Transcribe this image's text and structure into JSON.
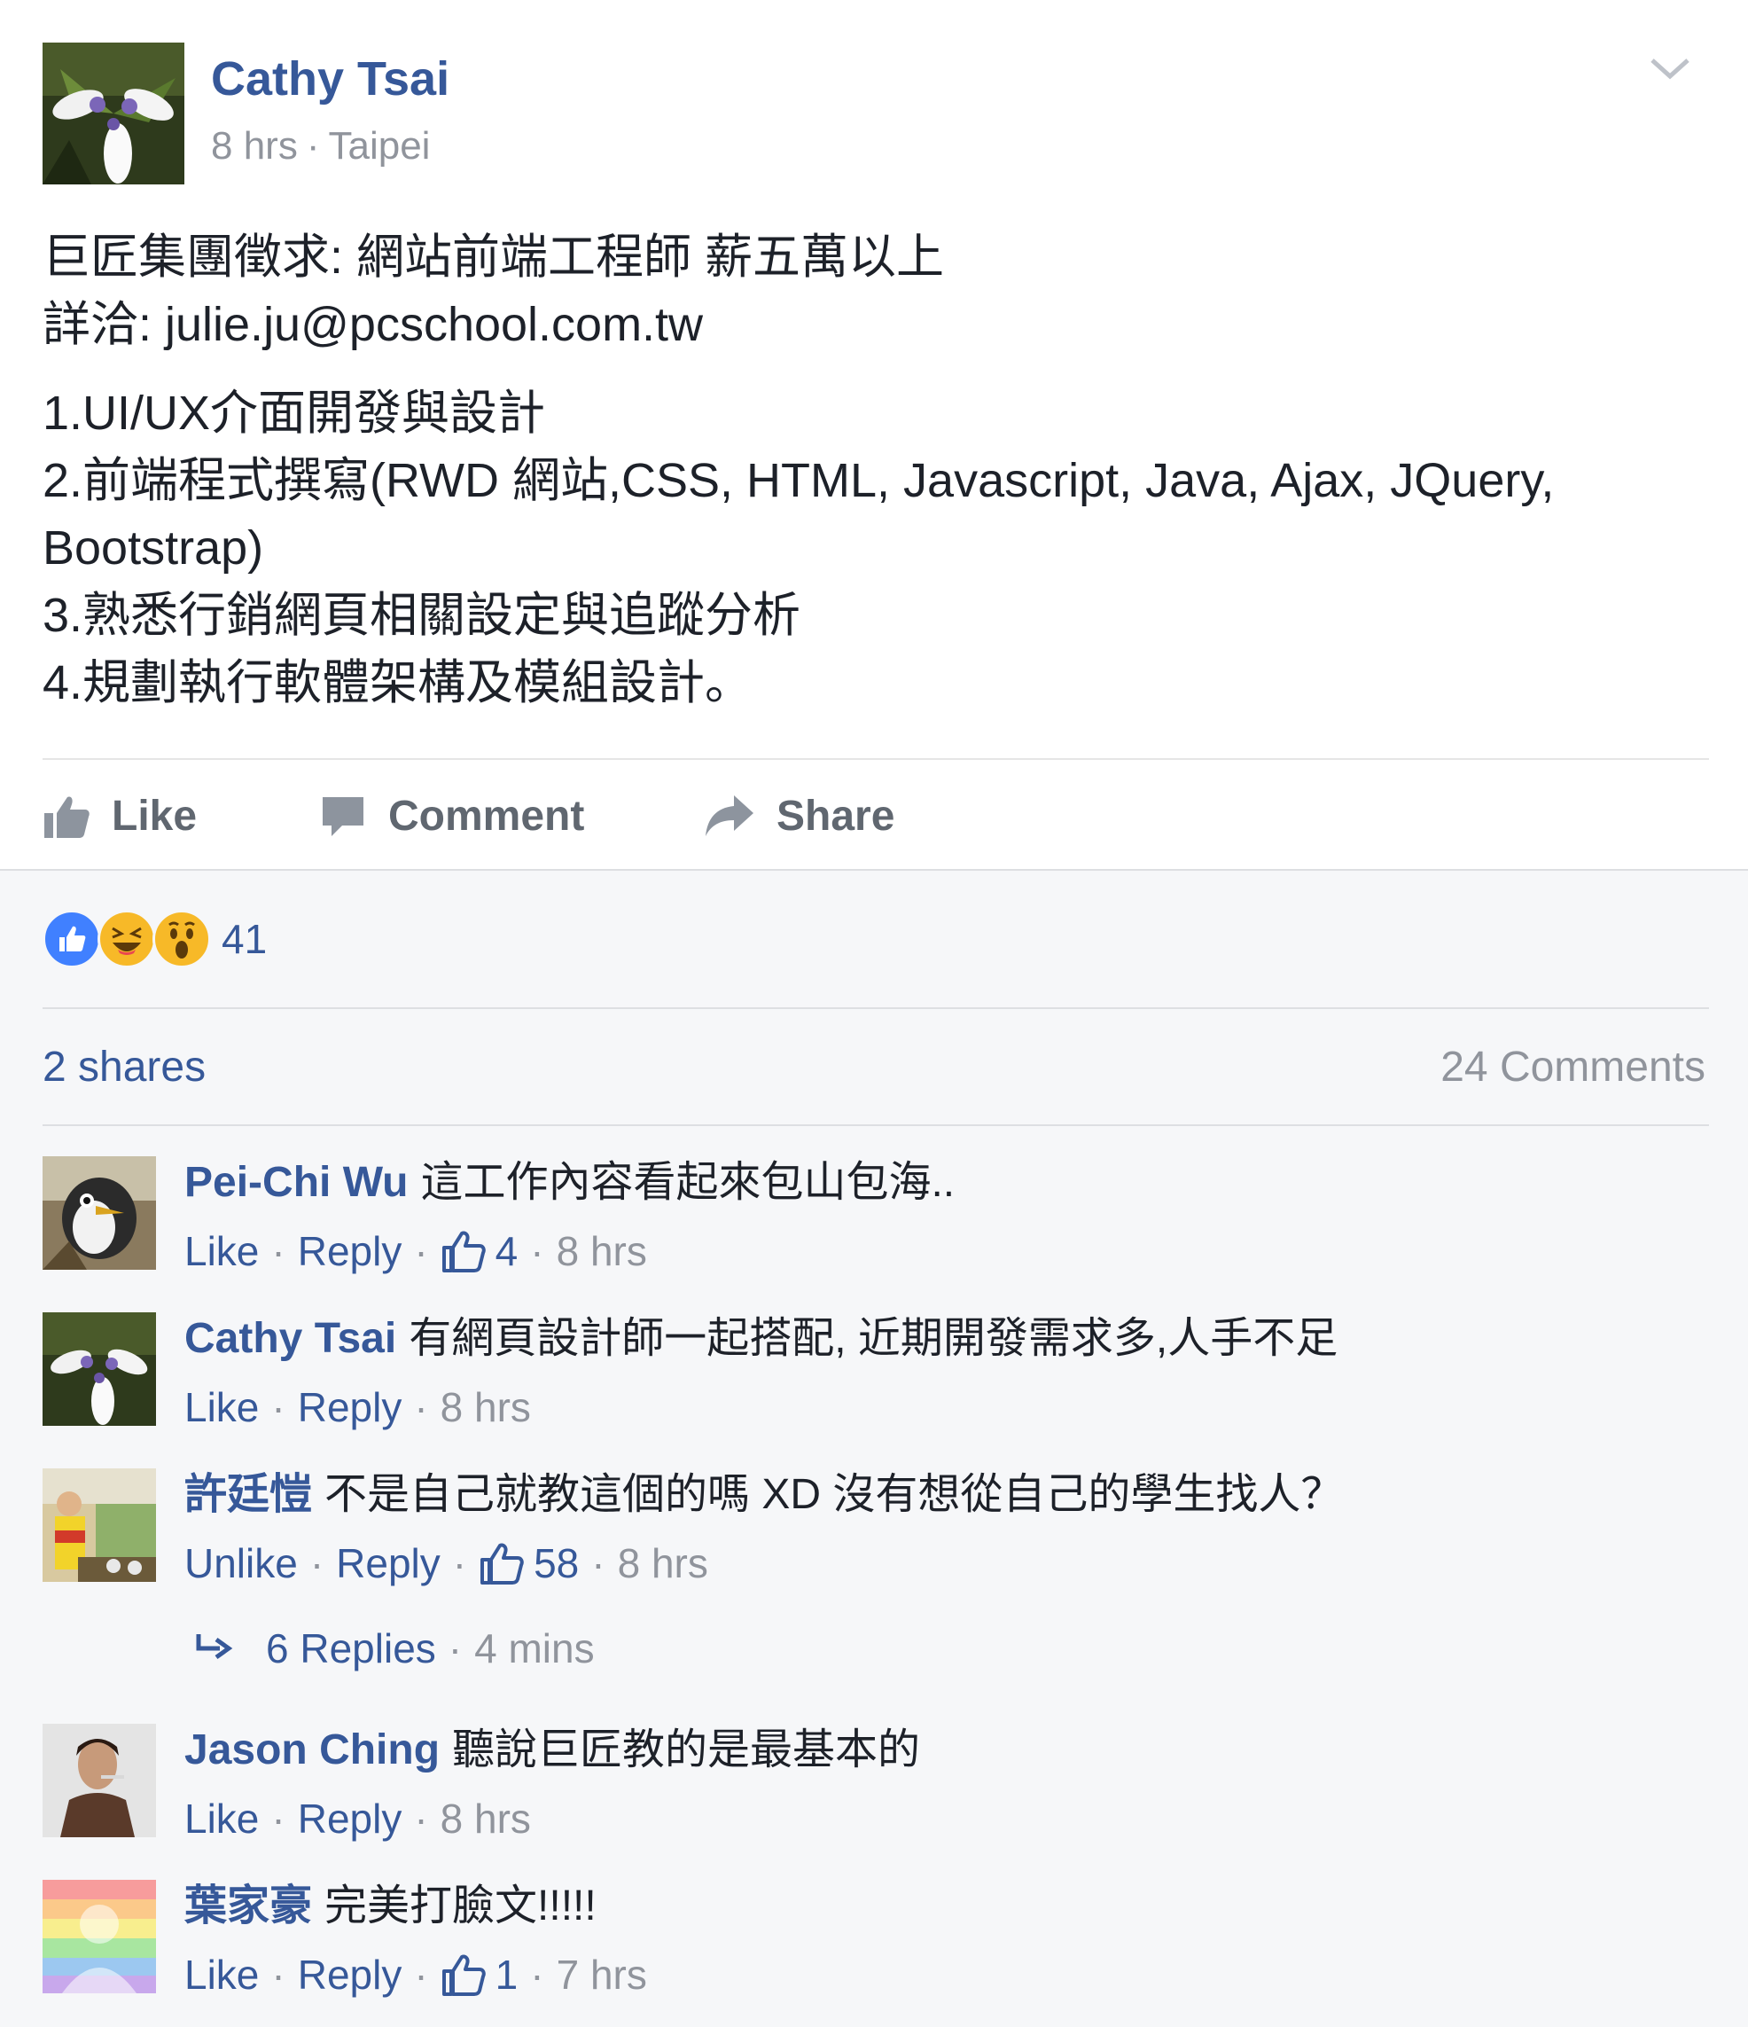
{
  "post": {
    "author": "Cathy Tsai",
    "time": "8 hrs",
    "location": "Taipei",
    "meta_separator": "·",
    "lines": [
      [
        "巨匠集團徵求: 網站前端工程師 薪五萬以上",
        "詳洽: julie.ju@pcschool.com.tw"
      ],
      [
        "1.UI/UX介面開發與設計",
        "2.前端程式撰寫(RWD 網站,CSS, HTML, Javascript, Java, Ajax, JQuery,",
        "Bootstrap)",
        "3.熟悉行銷網頁相關設定與追蹤分析",
        "4.規劃執行軟體架構及模組設計。"
      ]
    ],
    "actions": {
      "like": "Like",
      "comment": "Comment",
      "share": "Share"
    },
    "reaction_count": "41",
    "shares": "2 shares",
    "comments_count": "24 Comments",
    "colors": {
      "link": "#365899",
      "muted": "#90949c",
      "like_blue": "#4080ff",
      "emoji_yellow": "#f7b928"
    }
  },
  "comments": [
    {
      "name": "Pei-Chi Wu",
      "text": "這工作內容看起來包山包海..",
      "action": "Like",
      "reply": "Reply",
      "likes": "4",
      "time": "8 hrs"
    },
    {
      "name": "Cathy Tsai",
      "text": "有網頁設計師一起搭配, 近期開發需求多,人手不足",
      "action": "Like",
      "reply": "Reply",
      "likes": "",
      "time": "8 hrs"
    },
    {
      "name": "許廷愷",
      "text": "不是自己就教這個的嗎 XD 沒有想從自己的學生找人？",
      "action": "Unlike",
      "reply": "Reply",
      "likes": "58",
      "time": "8 hrs"
    },
    {
      "name": "Jason Ching",
      "text": "聽說巨匠教的是最基本的",
      "action": "Like",
      "reply": "Reply",
      "likes": "",
      "time": "8 hrs"
    },
    {
      "name": "葉家豪",
      "text": "完美打臉文!!!!!",
      "action": "Like",
      "reply": "Reply",
      "likes": "1",
      "time": "7 hrs"
    }
  ],
  "replies": {
    "label": "6 Replies",
    "time": "4 mins"
  }
}
